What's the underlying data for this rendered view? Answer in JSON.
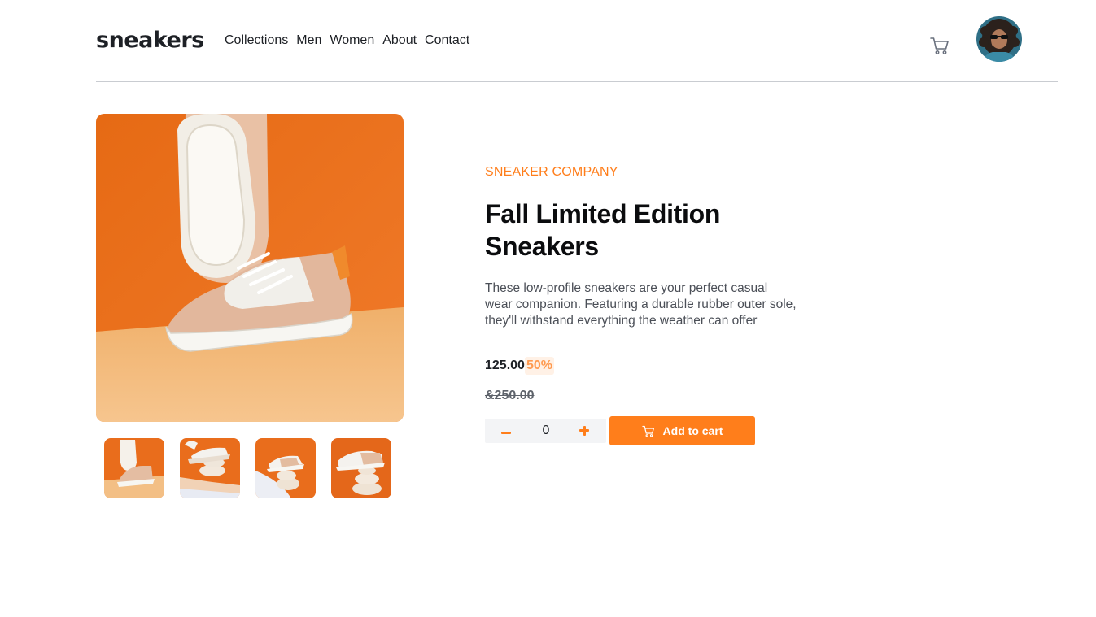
{
  "header": {
    "logo": "sneakers",
    "nav": [
      "Collections",
      "Men",
      "Women",
      "About",
      "Contact"
    ],
    "cart_icon": "cart-icon",
    "avatar_icon": "user-avatar"
  },
  "product": {
    "company": "SNEAKER COMPANY",
    "title": "Fall Limited Edition Sneakers",
    "description": "These low-profile sneakers are your perfect casual wear companion. Featuring a durable rubber outer sole, they'll withstand everything the weather can offer",
    "price": "125.00",
    "discount": "50%",
    "old_price": "&250.00",
    "quantity": "0",
    "add_to_cart": "Add to cart"
  },
  "gallery": {
    "main_image": "sneaker-main-photo",
    "thumbnails": [
      "thumbnail-1",
      "thumbnail-2",
      "thumbnail-3",
      "thumbnail-4"
    ]
  },
  "colors": {
    "accent": "#ff7e1b",
    "text": "#1d2025",
    "muted": "#5e636b"
  }
}
